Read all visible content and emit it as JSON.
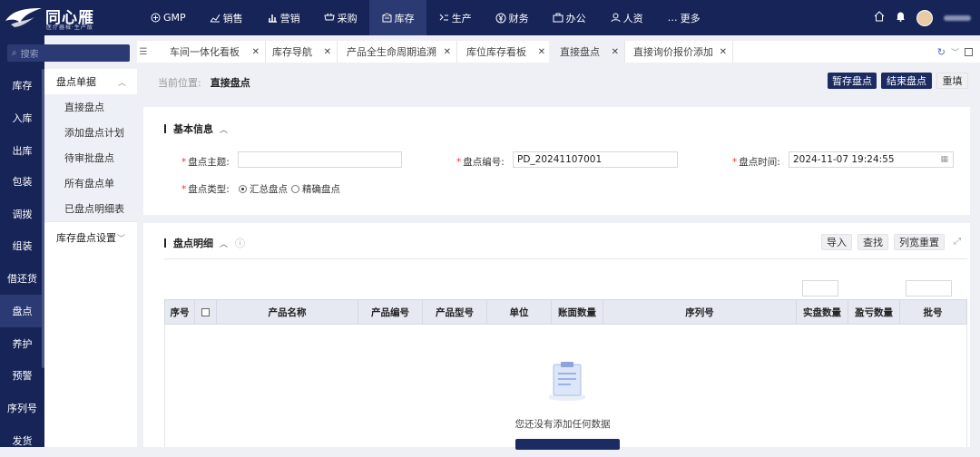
{
  "brand": {
    "name": "同心雁",
    "tagline": "医疗器械·生产版"
  },
  "nav": [
    {
      "icon": "gmp-icon",
      "label": "GMP"
    },
    {
      "icon": "chart-icon",
      "label": "销售"
    },
    {
      "icon": "bar-chart-icon",
      "label": "营销"
    },
    {
      "icon": "cart-icon",
      "label": "采购"
    },
    {
      "icon": "warehouse-icon",
      "label": "库存",
      "active": true
    },
    {
      "icon": "factory-icon",
      "label": "生产"
    },
    {
      "icon": "yen-icon",
      "label": "财务"
    },
    {
      "icon": "briefcase-icon",
      "label": "办公"
    },
    {
      "icon": "person-icon",
      "label": "人资"
    },
    {
      "icon": "more-icon",
      "label": "更多"
    }
  ],
  "search": {
    "placeholder": "搜索"
  },
  "sidebar": {
    "items": [
      "库存",
      "入库",
      "出库",
      "包装",
      "调拨",
      "组装",
      "借还货",
      "盘点",
      "养护",
      "预警",
      "序列号",
      "发货"
    ],
    "active": "盘点"
  },
  "subnav": {
    "group1": "盘点单据",
    "items": [
      "直接盘点",
      "添加盘点计划",
      "待审批盘点",
      "所有盘点单",
      "已盘点明细表"
    ],
    "group2": "库存盘点设置"
  },
  "tabs": [
    "车间一体化看板",
    "库存导航",
    "产品全生命周期追溯",
    "库位库存看板",
    "直接盘点",
    "直接询价报价添加"
  ],
  "active_tab": "直接盘点",
  "breadcrumb": {
    "label": "当前位置:",
    "current": "直接盘点"
  },
  "actions": {
    "save_draft": "暂存盘点",
    "finish": "结束盘点",
    "reset": "重填"
  },
  "basic": {
    "title": "基本信息",
    "subject_label": "盘点主题:",
    "subject_value": "",
    "code_label": "盘点编号:",
    "code_value": "PD_20241107001",
    "time_label": "盘点时间:",
    "time_value": "2024-11-07 19:24:55",
    "type_label": "盘点类型:",
    "type_options": [
      "汇总盘点",
      "精确盘点"
    ],
    "type_selected": "汇总盘点"
  },
  "detail": {
    "title": "盘点明细",
    "tools": [
      "导入",
      "查找",
      "列宽重置"
    ],
    "columns": [
      "序号",
      "",
      "产品名称",
      "产品编号",
      "产品型号",
      "单位",
      "账面数量",
      "序列号",
      "实盘数量",
      "盈亏数量",
      "批号"
    ],
    "empty_text": "您还没有添加任何数据"
  }
}
